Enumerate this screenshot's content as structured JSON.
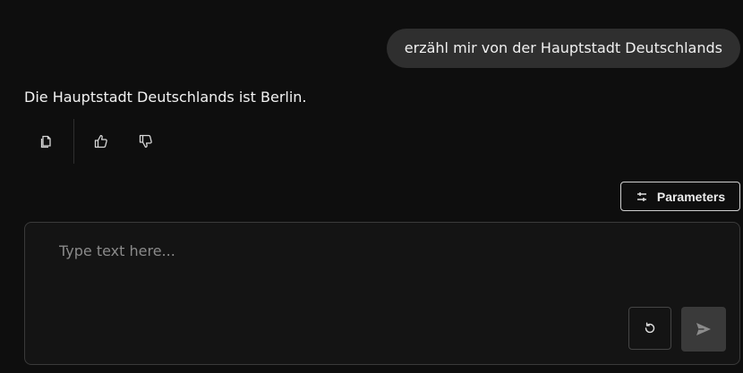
{
  "conversation": {
    "user_message": "erzähl mir von der Hauptstadt Deutschlands",
    "assistant_message": "Die Hauptstadt Deutschlands ist Berlin."
  },
  "message_actions": {
    "copy_icon": "copy-icon",
    "like_icon": "thumbs-up-icon",
    "dislike_icon": "thumbs-down-icon"
  },
  "parameters_button": {
    "label": "Parameters",
    "icon": "sliders-icon"
  },
  "composer": {
    "placeholder": "Type text here...",
    "value": "",
    "reset_icon": "reset-icon",
    "send_icon": "send-icon"
  },
  "colors": {
    "background": "#0e0e0e",
    "user_bubble": "#2f2f2f",
    "composer_background": "#141414",
    "send_button": "#3a3a3a"
  }
}
